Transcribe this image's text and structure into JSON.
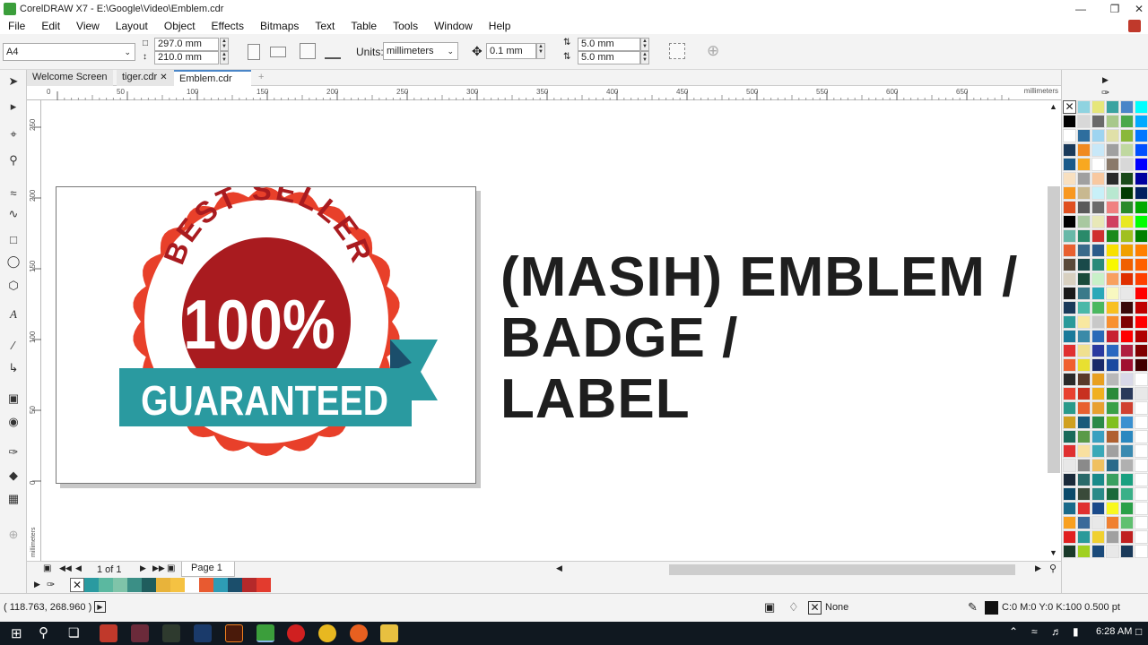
{
  "window": {
    "title": "CorelDRAW X7 - E:\\Google\\Video\\Emblem.cdr"
  },
  "menu": [
    "File",
    "Edit",
    "View",
    "Layout",
    "Object",
    "Effects",
    "Bitmaps",
    "Text",
    "Table",
    "Tools",
    "Window",
    "Help"
  ],
  "propbar": {
    "paper_size": "A4",
    "width": "297.0 mm",
    "height": "210.0 mm",
    "units_label": "Units:",
    "units": "millimeters",
    "nudge": "0.1 mm",
    "dup_x": "5.0 mm",
    "dup_y": "5.0 mm"
  },
  "tabs": [
    {
      "label": "Welcome Screen"
    },
    {
      "label": "tiger.cdr"
    },
    {
      "label": "Emblem.cdr"
    }
  ],
  "ruler": {
    "unit": "millimeters",
    "h_ticks": [
      "0",
      "50",
      "100",
      "150",
      "200",
      "250",
      "300",
      "350",
      "400",
      "450",
      "500",
      "550",
      "600",
      "650"
    ],
    "v_ticks": [
      "250",
      "200",
      "150",
      "100",
      "50",
      "0"
    ]
  },
  "badge": {
    "top_text": "BEST SELLER",
    "center_text": "100%",
    "ribbon_text": "GUARANTEED"
  },
  "headline": {
    "line1": "(MASIH) EMBLEM /",
    "line2": "BADGE /",
    "line3": "LABEL"
  },
  "pagenav": {
    "counter": "1 of 1",
    "page_tab": "Page 1"
  },
  "doc_palette_colors": [
    "#2a9aa0",
    "#5bb8a0",
    "#7fc4a9",
    "#3b8f86",
    "#1f5d5d",
    "#e8b33a",
    "#f5c242",
    "#ffffff",
    "#e85a30",
    "#2e9cb5",
    "#1b4e6b",
    "#b5292a",
    "#e33b2e"
  ],
  "palette_colors": [
    [
      "#ffffff",
      "#8fd3e0",
      "#e6e67a",
      "#3aa3a0",
      "#4a86c8",
      "#00ffff"
    ],
    [
      "#000000",
      "#d8d8d8",
      "#6a6a6a",
      "#a8c88a",
      "#4aa84a",
      "#00aaff"
    ],
    [
      "#ffffff",
      "#2e6e9e",
      "#9ed4f0",
      "#e0e0a8",
      "#8ab83a",
      "#0078ff"
    ],
    [
      "#1a3a5a",
      "#f08a20",
      "#c8e8f8",
      "#a0a0a0",
      "#c0d8a0",
      "#0050ff"
    ],
    [
      "#1a5a8a",
      "#f8a820",
      "#ffffff",
      "#8a7a6a",
      "#d8d8d8",
      "#0000ff"
    ],
    [
      "#f8e0c0",
      "#a0a0a0",
      "#f8c8a0",
      "#2a2a2a",
      "#1a4a1a",
      "#0000a0"
    ],
    [
      "#f89820",
      "#c8b890",
      "#c8f0f8",
      "#b8e8d0",
      "#003a00",
      "#002060"
    ],
    [
      "#e05020",
      "#5a5a5a",
      "#6a6a6a",
      "#f08080",
      "#2a8a2a",
      "#00aa00"
    ],
    [
      "#000000",
      "#a8c8a0",
      "#e8e8b8",
      "#d04060",
      "#e8e820",
      "#00ff00"
    ],
    [
      "#68b8a8",
      "#2a8a6a",
      "#d03030",
      "#1a8a1a",
      "#a0c020",
      "#008000"
    ],
    [
      "#e86030",
      "#3a6a8a",
      "#2a5a8a",
      "#f8e000",
      "#f0a000",
      "#ff8000"
    ],
    [
      "#5a4a3a",
      "#1a4a4a",
      "#2a8a7a",
      "#f8f800",
      "#f06000",
      "#ff6000"
    ],
    [
      "#d8d0c0",
      "#1a4a3a",
      "#c8f0c8",
      "#f8a060",
      "#e03000",
      "#ff4000"
    ],
    [
      "#1a1a1a",
      "#3a7a8a",
      "#2aa8b8",
      "#f8f8c0",
      "#e8e8e8",
      "#ff0000"
    ],
    [
      "#1a3a5a",
      "#4ab8a8",
      "#4ab860",
      "#f8c020",
      "#3a0a0a",
      "#c00000"
    ],
    [
      "#2a9a9a",
      "#f8e8a0",
      "#c8c8c8",
      "#f89030",
      "#800000",
      "#ff0000"
    ],
    [
      "#1a7a9a",
      "#3a8aa8",
      "#2a6ab8",
      "#c82030",
      "#ff0000",
      "#b00000"
    ],
    [
      "#e03030",
      "#f0e090",
      "#2a3aa0",
      "#2a68c0",
      "#b02040",
      "#800000"
    ],
    [
      "#f06030",
      "#e8e030",
      "#1a2a6a",
      "#1a4aa0",
      "#a01030",
      "#400000"
    ],
    [
      "#2a2a2a",
      "#5a3a2a",
      "#e8a020",
      "#b8b8b8",
      "#d8d8e8",
      "#ffffff"
    ],
    [
      "#e84030",
      "#c83020",
      "#f0b020",
      "#2a8a3a",
      "#2a3a5a",
      "#e8e8e8"
    ],
    [
      "#2a9a8a",
      "#e86030",
      "#e8a030",
      "#3aa048",
      "#d04030",
      "#ffffff"
    ],
    [
      "#d0a020",
      "#1a5a7a",
      "#2a8a48",
      "#80c020",
      "#3a90d0",
      "#ffffff"
    ],
    [
      "#1a6a5a",
      "#5a9a48",
      "#3aa0c0",
      "#b06030",
      "#2a88c0",
      "#ffffff"
    ],
    [
      "#e03030",
      "#f8e0a0",
      "#3aa8b8",
      "#a0a0a0",
      "#3a8ab0",
      "#ffffff"
    ],
    [
      "#e8e8e8",
      "#8a8a8a",
      "#f0c060",
      "#2a6a8a",
      "#b0b0b0",
      "#ffffff"
    ],
    [
      "#1a2a3a",
      "#2a6a6a",
      "#1a8a8a",
      "#3aa060",
      "#1aa080",
      "#ffffff"
    ],
    [
      "#0a4a6a",
      "#3a4a3a",
      "#2a8a88",
      "#1a6a3a",
      "#3ab088",
      "#ffffff"
    ],
    [
      "#1a6a8a",
      "#e03030",
      "#1a4a8a",
      "#f8f820",
      "#2aa048",
      "#ffffff"
    ],
    [
      "#f8a020",
      "#3a6a9a",
      "#e8e8e8",
      "#f08030",
      "#60c070",
      "#ffffff"
    ],
    [
      "#e02020",
      "#2a9a9a",
      "#f0d030",
      "#a0a0a0",
      "#c02020",
      "#ffffff"
    ],
    [
      "#1a3a2a",
      "#a0d020",
      "#1a4a7a",
      "#e8e8e8",
      "#1a3a5a",
      "#ffffff"
    ]
  ],
  "status": {
    "coords": "( 118.763, 268.960 )",
    "fill_label": "None",
    "outline": "C:0 M:0 Y:0 K:100  0.500 pt"
  },
  "taskbar": {
    "time": "6:28 AM"
  }
}
